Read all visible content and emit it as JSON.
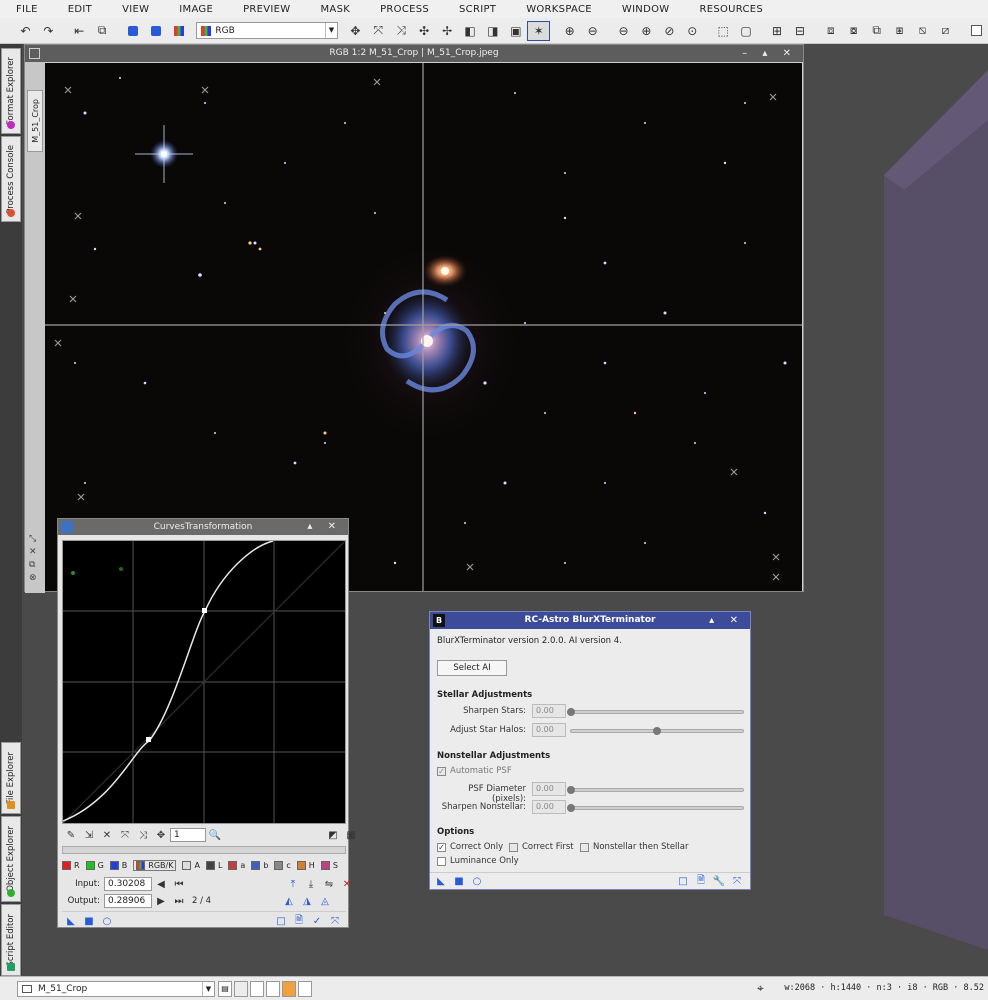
{
  "menu": [
    "FILE",
    "EDIT",
    "VIEW",
    "IMAGE",
    "PREVIEW",
    "MASK",
    "PROCESS",
    "SCRIPT",
    "WORKSPACE",
    "WINDOW",
    "RESOURCES"
  ],
  "toolbar": {
    "channel_select": "RGB"
  },
  "side_tabs": {
    "format_explorer": "Format Explorer",
    "process_console": "Process Console",
    "file_explorer": "File Explorer",
    "object_explorer": "Object Explorer",
    "script_editor": "Script Editor"
  },
  "image_window": {
    "title": "RGB 1:2 M_51_Crop | M_51_Crop.jpeg",
    "view_tab": "M_51_Crop"
  },
  "curves": {
    "title": "CurvesTransformation",
    "zoom_value": "1",
    "channels": [
      {
        "label": "R",
        "color": "#e02020"
      },
      {
        "label": "G",
        "color": "#20c020"
      },
      {
        "label": "B",
        "color": "#2040e0"
      },
      {
        "label": "RGB/K",
        "color": "#999999"
      },
      {
        "label": "A",
        "color": "#cccccc"
      },
      {
        "label": "L",
        "color": "#444444"
      },
      {
        "label": "a",
        "color": "#c04040"
      },
      {
        "label": "b",
        "color": "#4060c0"
      },
      {
        "label": "c",
        "color": "#888888"
      },
      {
        "label": "H",
        "color": "#d08030"
      },
      {
        "label": "S",
        "color": "#c04080"
      }
    ],
    "input_label": "Input:",
    "input_value": "0.30208",
    "output_label": "Output:",
    "output_value": "0.28906",
    "point_counter": "2 / 4"
  },
  "bxt": {
    "title": "RC-Astro BlurXTerminator",
    "version": "BlurXTerminator version 2.0.0. AI version 4.",
    "select_ai": "Select AI",
    "stellar_header": "Stellar Adjustments",
    "sharpen_stars_label": "Sharpen Stars:",
    "sharpen_stars_value": "0.00",
    "sharpen_stars_level": 0.0,
    "adjust_halos_label": "Adjust Star Halos:",
    "adjust_halos_value": "0.00",
    "adjust_halos_level": 0.5,
    "nonstellar_header": "Nonstellar Adjustments",
    "automatic_psf": "Automatic PSF",
    "psf_diameter_label": "PSF Diameter (pixels):",
    "psf_diameter_value": "0.00",
    "psf_diameter_level": 0.0,
    "sharpen_nonstellar_label": "Sharpen Nonstellar:",
    "sharpen_nonstellar_value": "0.00",
    "sharpen_nonstellar_level": 0.0,
    "options_header": "Options",
    "correct_only": "Correct Only",
    "correct_first": "Correct First",
    "nonstellar_then_stellar": "Nonstellar then Stellar",
    "luminance_only": "Luminance Only"
  },
  "statusbar": {
    "view_select": "M_51_Crop",
    "info": "w:2068 · h:1440 · n:3 · i8 · RGB · 8.52"
  },
  "colors": {
    "bxt_title": "#3d4c9a",
    "desktop": "#4a4a4a",
    "shape": "#574e68"
  }
}
